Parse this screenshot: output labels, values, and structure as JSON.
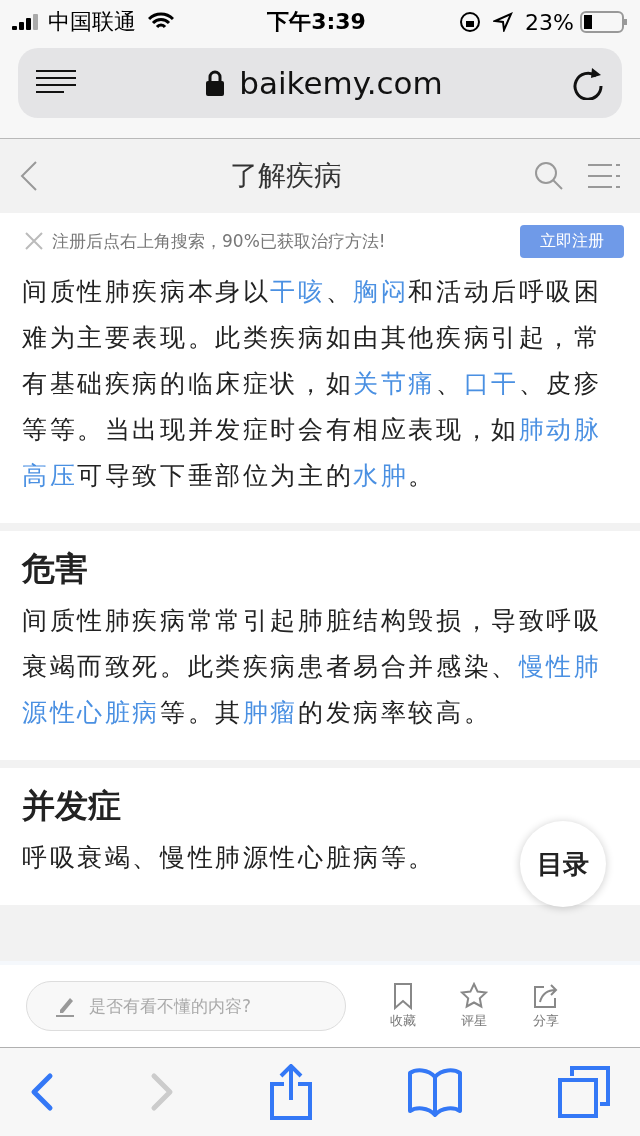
{
  "status_bar": {
    "carrier": "中国联通",
    "time": "下午3:39",
    "battery": "23%"
  },
  "url_bar": {
    "domain": "baikemy.com"
  },
  "header": {
    "title": "了解疾病"
  },
  "banner": {
    "text": "注册后点右上角搜索，90%已获取治疗方法!",
    "button": "立即注册"
  },
  "sections": [
    {
      "lines": [
        [
          {
            "text": "间质性肺疾病本身以",
            "link": false
          },
          {
            "text": "干咳",
            "link": true
          },
          {
            "text": "、",
            "link": false
          },
          {
            "text": "胸闷",
            "link": true
          },
          {
            "text": "和活动后呼吸困",
            "link": false
          }
        ],
        [
          {
            "text": "难为主要表现。此类疾病如由其他疾病引起，常",
            "link": false
          }
        ],
        [
          {
            "text": "有基础疾病的临床症状，如",
            "link": false
          },
          {
            "text": "关节痛",
            "link": true
          },
          {
            "text": "、",
            "link": false
          },
          {
            "text": "口干",
            "link": true
          },
          {
            "text": "、皮疹",
            "link": false
          }
        ],
        [
          {
            "text": "等等。当出现并发症时会有相应表现，如",
            "link": false
          },
          {
            "text": "肺动脉",
            "link": true
          }
        ],
        [
          {
            "text": "高压",
            "link": true
          },
          {
            "text": "可导致下垂部位为主的",
            "link": false
          },
          {
            "text": "水肿",
            "link": true
          },
          {
            "text": "。",
            "link": false
          }
        ]
      ]
    },
    {
      "heading": "危害",
      "lines": [
        [
          {
            "text": "间质性肺疾病常常引起肺脏结构毁损，导致呼吸",
            "link": false
          }
        ],
        [
          {
            "text": "衰竭而致死。此类疾病患者易合并感染、",
            "link": false
          },
          {
            "text": "慢性肺",
            "link": true
          }
        ],
        [
          {
            "text": "源性心脏病",
            "link": true
          },
          {
            "text": "等。其",
            "link": false
          },
          {
            "text": "肿瘤",
            "link": true
          },
          {
            "text": "的发病率较高。",
            "link": false
          }
        ]
      ]
    },
    {
      "heading": "并发症",
      "lines": [
        [
          {
            "text": "呼吸衰竭、慢性肺源性心脏病等。",
            "link": false
          }
        ]
      ]
    }
  ],
  "toc_button": "目录",
  "comment_bar": {
    "placeholder": "是否有看不懂的内容?",
    "actions": [
      {
        "kind": "bookmark",
        "label": "收藏"
      },
      {
        "kind": "star",
        "label": "评星"
      },
      {
        "kind": "share",
        "label": "分享"
      }
    ]
  },
  "toolbar": {
    "back_disabled": false,
    "forward_disabled": true
  }
}
